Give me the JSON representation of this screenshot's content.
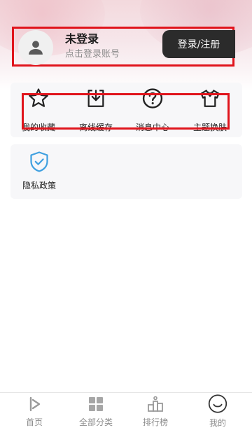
{
  "profile": {
    "title": "未登录",
    "subtitle": "点击登录账号",
    "login_button": "登录/注册",
    "avatar_icon": "person-icon"
  },
  "menu": {
    "items": [
      {
        "label": "我的收藏",
        "icon": "star-icon"
      },
      {
        "label": "离线缓存",
        "icon": "download-icon"
      },
      {
        "label": "消息中心",
        "icon": "question-icon"
      },
      {
        "label": "主题换肤",
        "icon": "tshirt-icon"
      }
    ]
  },
  "privacy": {
    "label": "隐私政策",
    "icon": "shield-check-icon"
  },
  "bottom_nav": {
    "items": [
      {
        "label": "首页",
        "icon": "home-play-icon"
      },
      {
        "label": "全部分类",
        "icon": "grid-icon"
      },
      {
        "label": "排行榜",
        "icon": "ranking-icon"
      },
      {
        "label": "我的",
        "icon": "smile-icon"
      }
    ]
  },
  "colors": {
    "highlight_border": "#e0141c",
    "login_button_bg": "#2b2b2b",
    "accent_blue": "#3fa0e0",
    "nav_inactive": "#8c8c8c"
  }
}
